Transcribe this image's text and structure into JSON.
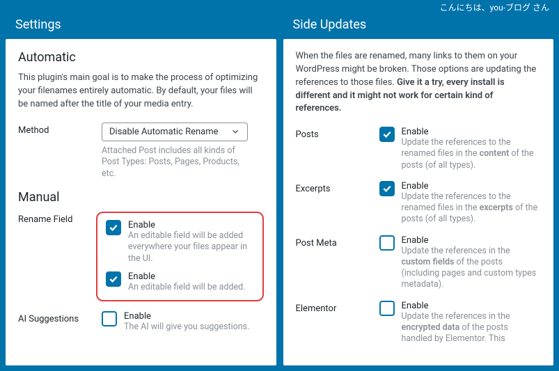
{
  "greeting": "こんにちは、you-ブログ さん",
  "left": {
    "title": "Settings",
    "automatic": {
      "heading": "Automatic",
      "intro": "This plugin's main goal is to make the process of optimizing your filenames entirely automatic. By default, your files will be named after the title of your media entry.",
      "method_label": "Method",
      "method_value": "Disable Automatic Rename",
      "method_help": "Attached Post includes all kinds of Post Types: Posts, Pages, Products, etc."
    },
    "manual": {
      "heading": "Manual",
      "rename_label": "Rename Field",
      "rename1": {
        "label": "Enable",
        "desc": "An editable field will be added everywhere your files appear in the UI."
      },
      "rename2": {
        "label": "Enable",
        "desc": "An editable field will be added."
      },
      "ai_label": "AI Suggestions",
      "ai": {
        "label": "Enable",
        "desc": "The AI will give you suggestions."
      }
    }
  },
  "right": {
    "title": "Side Updates",
    "intro_plain": "When the files are renamed, many links to them on your WordPress might be broken. Those options are updating the references to those files. ",
    "intro_bold": "Give it a try, every install is different and it might not work for certain kind of references.",
    "posts": {
      "label": "Posts",
      "check": "Enable",
      "desc1": "Update the references to the renamed files in the ",
      "desc_bold": "content",
      "desc2": " of the posts (of all types)."
    },
    "excerpts": {
      "label": "Excerpts",
      "check": "Enable",
      "desc1": "Update the references to the renamed files in the ",
      "desc_bold": "excerpts",
      "desc2": " of the posts (of all types)."
    },
    "postmeta": {
      "label": "Post Meta",
      "check": "Enable",
      "desc1": "Update the references in the ",
      "desc_bold": "custom fields",
      "desc2": " of the posts (including pages and custom types metadata)."
    },
    "elementor": {
      "label": "Elementor",
      "check": "Enable",
      "desc1": "Update the references in the ",
      "desc_bold": "encrypted data",
      "desc2": " of the posts handled by Elementor. This"
    }
  }
}
